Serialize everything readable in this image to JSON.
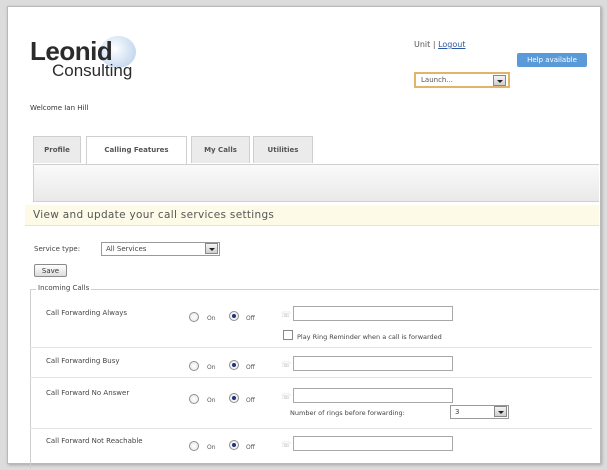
{
  "brand": {
    "line1": "Leonid",
    "line2": "Consulting"
  },
  "top_links": {
    "unit": "Unit",
    "separator": "|",
    "logout": "Logout"
  },
  "help": {
    "label": "Help available"
  },
  "launch": {
    "value": "Launch..."
  },
  "welcome": "Welcome Ian Hill",
  "tabs": [
    {
      "label": "Profile",
      "active": false
    },
    {
      "label": "Calling Features",
      "active": true
    },
    {
      "label": "My Calls",
      "active": false
    },
    {
      "label": "Utilities",
      "active": false
    }
  ],
  "heading": "View and update your call services settings",
  "service_type": {
    "label": "Service type:",
    "value": "All Services"
  },
  "save_label": "Save",
  "incoming": {
    "legend": "Incoming Calls",
    "on_label": "On",
    "off_label": "Off",
    "rows": [
      {
        "label": "Call Forwarding Always",
        "selected": "off",
        "extra": "Play Ring Reminder when a call is forwarded"
      },
      {
        "label": "Call Forwarding Busy",
        "selected": "off"
      },
      {
        "label": "Call Forward No Answer",
        "selected": "off",
        "extra": "Number of rings before forwarding:",
        "rings_value": "3"
      },
      {
        "label": "Call Forward Not Reachable",
        "selected": "off"
      }
    ]
  },
  "colors": {
    "accent": "#5a9ad8",
    "link": "#2a55a5",
    "heading_bg": "#fdfbe8",
    "launch_border": "#e3b36a"
  }
}
